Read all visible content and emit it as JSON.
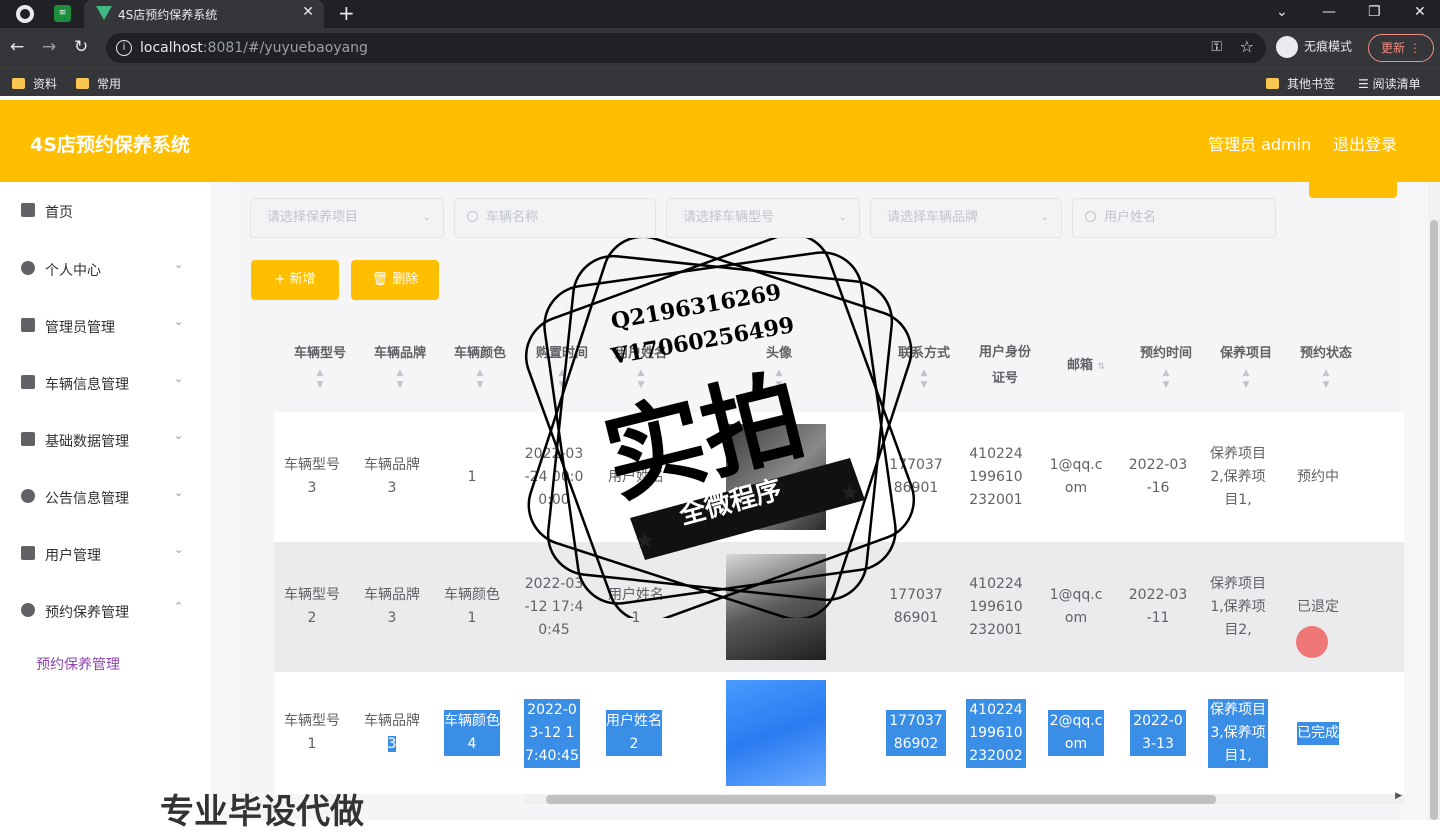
{
  "browser": {
    "tab_title": "4S店预约保养系统",
    "url_host": "localhost",
    "url_rest": ":8081/#/yuyuebaoyang",
    "incognito_label": "无痕模式",
    "update_label": "更新",
    "bookmarks": [
      "资料",
      "常用"
    ],
    "other_bookmarks": "其他书签",
    "reading_list": "阅读清单"
  },
  "header": {
    "title": "4S店预约保养系统",
    "user": "管理员 admin",
    "logout": "退出登录",
    "color": "#ffbe00"
  },
  "sidebar": {
    "items": [
      {
        "label": "首页",
        "icon": "home-icon"
      },
      {
        "label": "个人中心",
        "icon": "user-icon"
      },
      {
        "label": "管理员管理",
        "icon": "list-icon"
      },
      {
        "label": "车辆信息管理",
        "icon": "clipboard-icon"
      },
      {
        "label": "基础数据管理",
        "icon": "list-icon"
      },
      {
        "label": "公告信息管理",
        "icon": "info-icon"
      },
      {
        "label": "用户管理",
        "icon": "monitor-icon"
      },
      {
        "label": "预约保养管理",
        "icon": "bulb-icon"
      }
    ],
    "sub_item": "预约保养管理"
  },
  "filters": {
    "project": "请选择保养项目",
    "car_name": "车辆名称",
    "car_type": "请选择车辆型号",
    "car_brand": "请选择车辆品牌",
    "user_name": "用户姓名"
  },
  "actions": {
    "add": "+ 新增",
    "delete": "删除"
  },
  "table": {
    "headers": [
      "车辆型号",
      "车辆品牌",
      "车辆颜色",
      "购置时间",
      "用户姓名",
      "头像",
      "联系方式",
      "用户身份证号",
      "邮箱",
      "预约时间",
      "保养项目",
      "预约状态"
    ],
    "rows": [
      {
        "type": "车辆型号3",
        "brand": "车辆品牌3",
        "color": "1",
        "buy_time": "2022-03-24 00:00:00",
        "user": "用户姓名",
        "phone": "17703786901",
        "idcard": "410224199610232001",
        "email": "1@qq.com",
        "appt": "2022-03-16",
        "project": "保养项目2,保养项目1,",
        "status": "预约中"
      },
      {
        "type": "车辆型号2",
        "brand": "车辆品牌3",
        "color": "车辆颜色1",
        "buy_time": "2022-03-12 17:40:45",
        "user": "用户姓名1",
        "phone": "17703786901",
        "idcard": "410224199610232001",
        "email": "1@qq.com",
        "appt": "2022-03-11",
        "project": "保养项目1,保养项目2,",
        "status": "已退定"
      },
      {
        "type": "车辆型号1",
        "brand": "车辆品牌",
        "brand_hl": "3",
        "color": "车辆颜色4",
        "buy_time": "2022-03-12 17:40:45",
        "user": "用户姓名2",
        "phone": "17703786902",
        "idcard": "410224199610232002",
        "email": "2@qq.com",
        "appt": "2022-03-13",
        "project": "保养项目3,保养项目1,",
        "status": "已完成"
      }
    ]
  },
  "watermark": {
    "line1": "Q2196316269",
    "line2": "V17060256499",
    "big": "实拍",
    "ribbon": "全微程序",
    "bottom": "专业毕设代做"
  }
}
